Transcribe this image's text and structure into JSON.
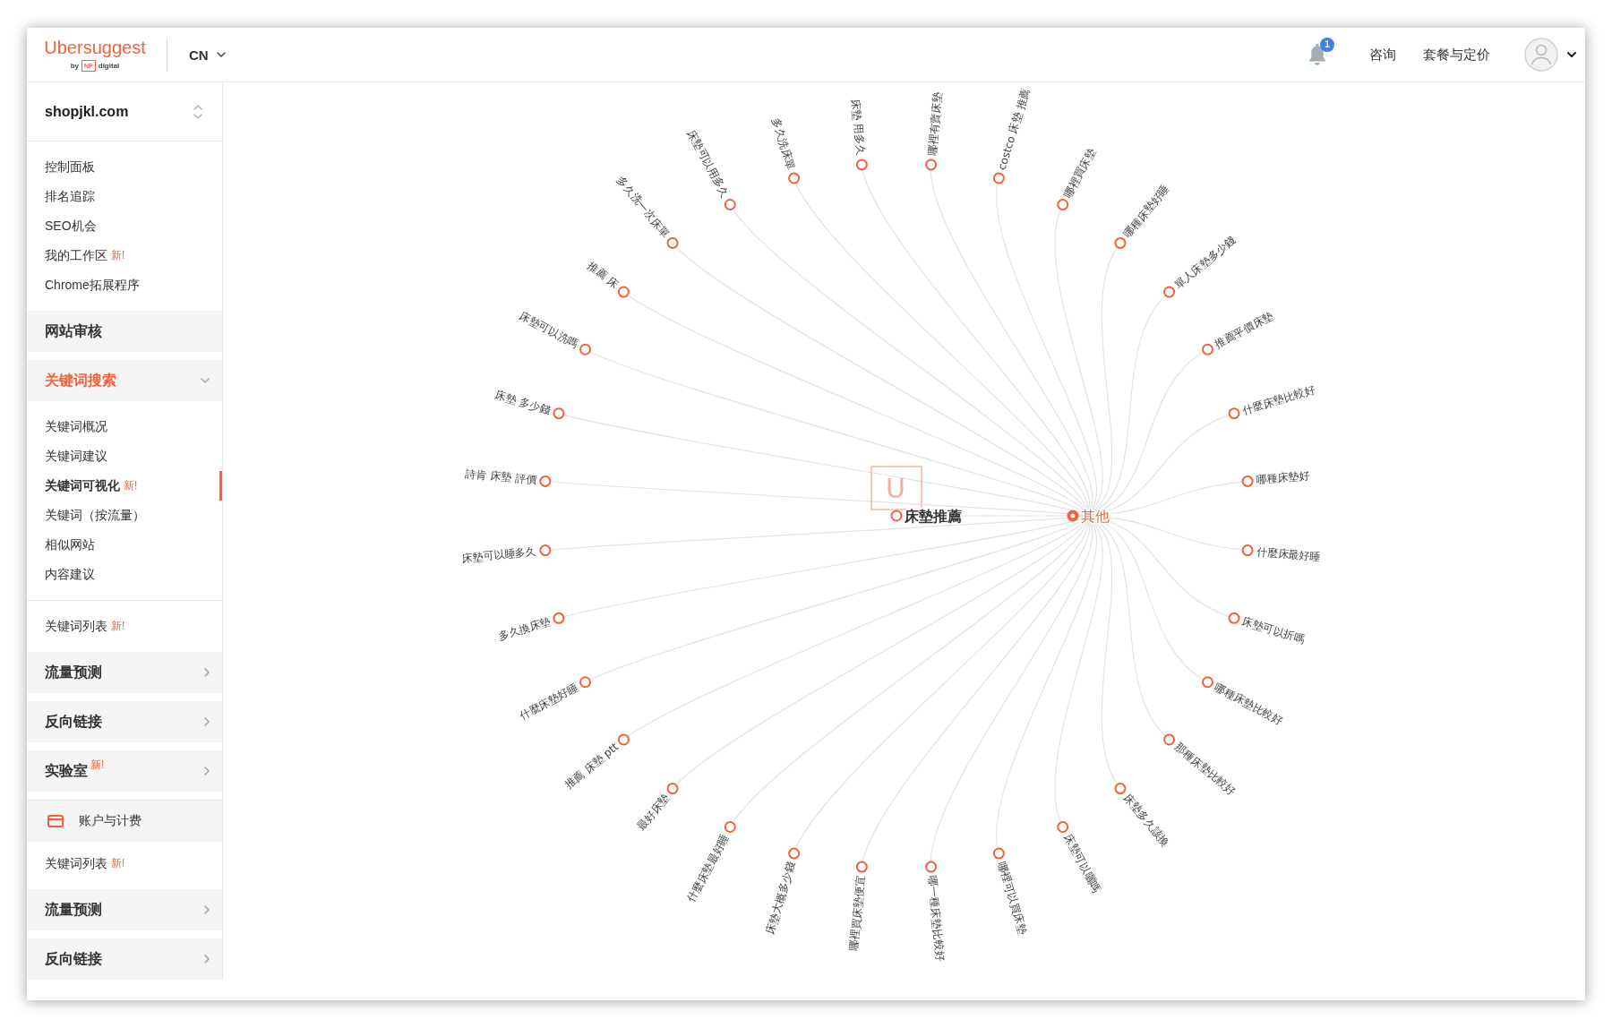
{
  "header": {
    "logo": {
      "wordmark": "Ubersuggest",
      "byline_prefix": "by",
      "byline_mark": "NP",
      "byline_suffix": "digital"
    },
    "language": "CN",
    "notification_count": "1",
    "links": [
      "咨询",
      "套餐与定价"
    ]
  },
  "sidebar": {
    "project": "shopjkl.com",
    "menu": [
      {
        "kind": "list",
        "items": [
          {
            "label": "控制面板",
            "selected": false
          },
          {
            "label": "排名追踪",
            "selected": false
          },
          {
            "label": "SEO机会",
            "selected": false
          },
          {
            "label": "我的工作区",
            "tag": "新!",
            "selected": false
          },
          {
            "label": "Chrome拓展程序",
            "selected": false
          }
        ]
      },
      {
        "kind": "link",
        "label": "网站审核"
      },
      {
        "kind": "group",
        "label": "关键词搜索",
        "expanded": true,
        "items": [
          {
            "label": "关键词概况",
            "selected": false
          },
          {
            "label": "关键词建议",
            "selected": false
          },
          {
            "label": "关键词可视化",
            "tag": "新!",
            "selected": true
          },
          {
            "label": "关键词（按流量）",
            "selected": false
          },
          {
            "label": "相似网站",
            "selected": false
          },
          {
            "label": "内容建议",
            "selected": false
          }
        ]
      },
      {
        "kind": "list",
        "items": [
          {
            "label": "关键词列表",
            "tag": "新!",
            "selected": false
          }
        ]
      },
      {
        "kind": "group",
        "label": "流量预测",
        "expanded": false
      },
      {
        "kind": "group",
        "label": "反向链接",
        "expanded": false
      },
      {
        "kind": "group",
        "label": "实验室",
        "tag": "新!",
        "expanded": false
      },
      {
        "kind": "account",
        "label": "账户与计费"
      },
      {
        "kind": "list",
        "items": [
          {
            "label": "关键词列表",
            "tag": "新!",
            "selected": false
          }
        ]
      },
      {
        "kind": "group",
        "label": "流量预测",
        "expanded": false
      },
      {
        "kind": "group",
        "label": "反向链接",
        "expanded": false
      }
    ]
  },
  "keyword_tree": {
    "root": {
      "label": "床墊推薦",
      "badge": "U",
      "children": [
        {
          "label": "其他",
          "children": [
            {
              "label": "哪裡有賣床墊"
            },
            {
              "label": "costco 床墊 推薦"
            },
            {
              "label": "哪裡買床墊"
            },
            {
              "label": "哪種床墊好睡"
            },
            {
              "label": "單人床墊多少錢"
            },
            {
              "label": "推薦平價床墊"
            },
            {
              "label": "什麼床墊比較好"
            },
            {
              "label": "哪種床墊好"
            },
            {
              "label": "什麼床最好睡"
            },
            {
              "label": "床墊可以折嗎"
            },
            {
              "label": "哪種床墊比較好"
            },
            {
              "label": "那種床墊比較好"
            },
            {
              "label": "床墊多久該換"
            },
            {
              "label": "床墊可以曬嗎"
            },
            {
              "label": "哪裡可以買床墊"
            },
            {
              "label": "哪一種床墊比較好"
            },
            {
              "label": "哪裡買床墊便宜"
            },
            {
              "label": "床墊大概多少錢"
            },
            {
              "label": "什麼床墊最好睡"
            },
            {
              "label": "最好床墊"
            },
            {
              "label": "推薦 床墊 ptt"
            },
            {
              "label": "什麼床墊好睡"
            },
            {
              "label": "多久換床墊"
            },
            {
              "label": "床墊可以睡多久"
            },
            {
              "label": "詩肯 床墊 評價"
            },
            {
              "label": "床墊 多少錢"
            },
            {
              "label": "床墊可以洗嗎"
            },
            {
              "label": "推薦 床"
            },
            {
              "label": "多久洗一次床單"
            },
            {
              "label": "床墊可以用多久"
            },
            {
              "label": "多久洗床單"
            },
            {
              "label": "床墊 用多久"
            }
          ]
        }
      ]
    }
  }
}
